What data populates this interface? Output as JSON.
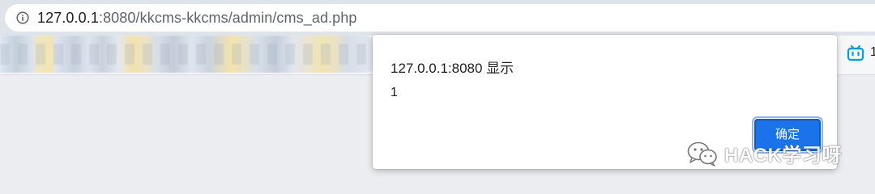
{
  "address_bar": {
    "url_host": "127.0.0.1",
    "url_rest": ":8080/kkcms-kkcms/admin/cms_ad.php",
    "icon": "info-icon"
  },
  "bookmarks_bar": {
    "right_icon": "bilibili-icon",
    "right_text": "1"
  },
  "alert_dialog": {
    "title": "127.0.0.1:8080 显示",
    "message": "1",
    "ok_label": "确定",
    "accent_color": "#1a73e8"
  },
  "watermark": {
    "icon": "wechat-icon",
    "text": "HACK学习呀"
  }
}
